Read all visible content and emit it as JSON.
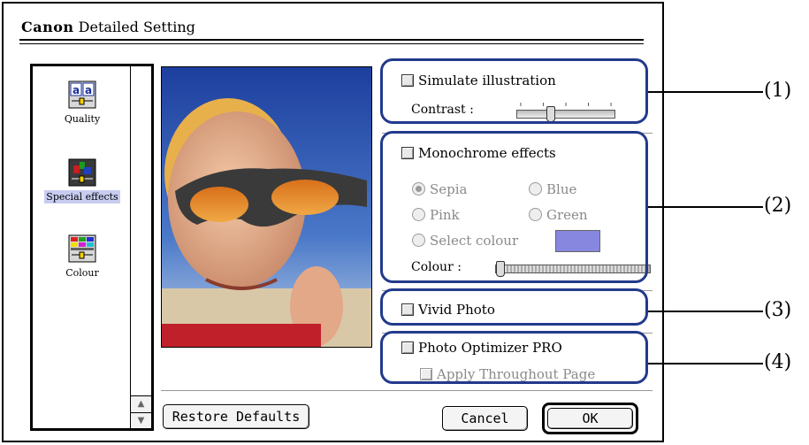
{
  "window": {
    "brand": "Canon",
    "title": "Detailed Setting"
  },
  "nav": {
    "items": [
      {
        "label": "Quality",
        "icon": "quality-icon",
        "active": false
      },
      {
        "label": "Special effects",
        "icon": "special-effects-icon",
        "active": true
      },
      {
        "label": "Colour",
        "icon": "colour-icon",
        "active": false
      }
    ]
  },
  "options": {
    "simulate_illustration": {
      "label": "Simulate illustration",
      "checked": false
    },
    "contrast": {
      "label": "Contrast :",
      "level": 0.33
    },
    "monochrome_effects": {
      "label": "Monochrome effects",
      "checked": false
    },
    "radios": {
      "sepia": "Sepia",
      "blue": "Blue",
      "pink": "Pink",
      "green": "Green",
      "select_colour": "Select colour"
    },
    "selected_radio": "Sepia",
    "swatch_color": "#8787e0",
    "colour": {
      "label": "Colour :",
      "level": 0.0
    },
    "vivid_photo": {
      "label": "Vivid Photo",
      "checked": false
    },
    "photo_optimizer": {
      "label": "Photo Optimizer PRO",
      "checked": false
    },
    "apply_throughout": {
      "label": "Apply Throughout Page",
      "checked": false,
      "enabled": false
    }
  },
  "callouts": [
    "(1)",
    "(2)",
    "(3)",
    "(4)"
  ],
  "buttons": {
    "restore": "Restore Defaults",
    "cancel": "Cancel",
    "ok": "OK"
  },
  "colors": {
    "callout_border": "#223a8c",
    "selection_highlight": "#c8ccf0"
  }
}
